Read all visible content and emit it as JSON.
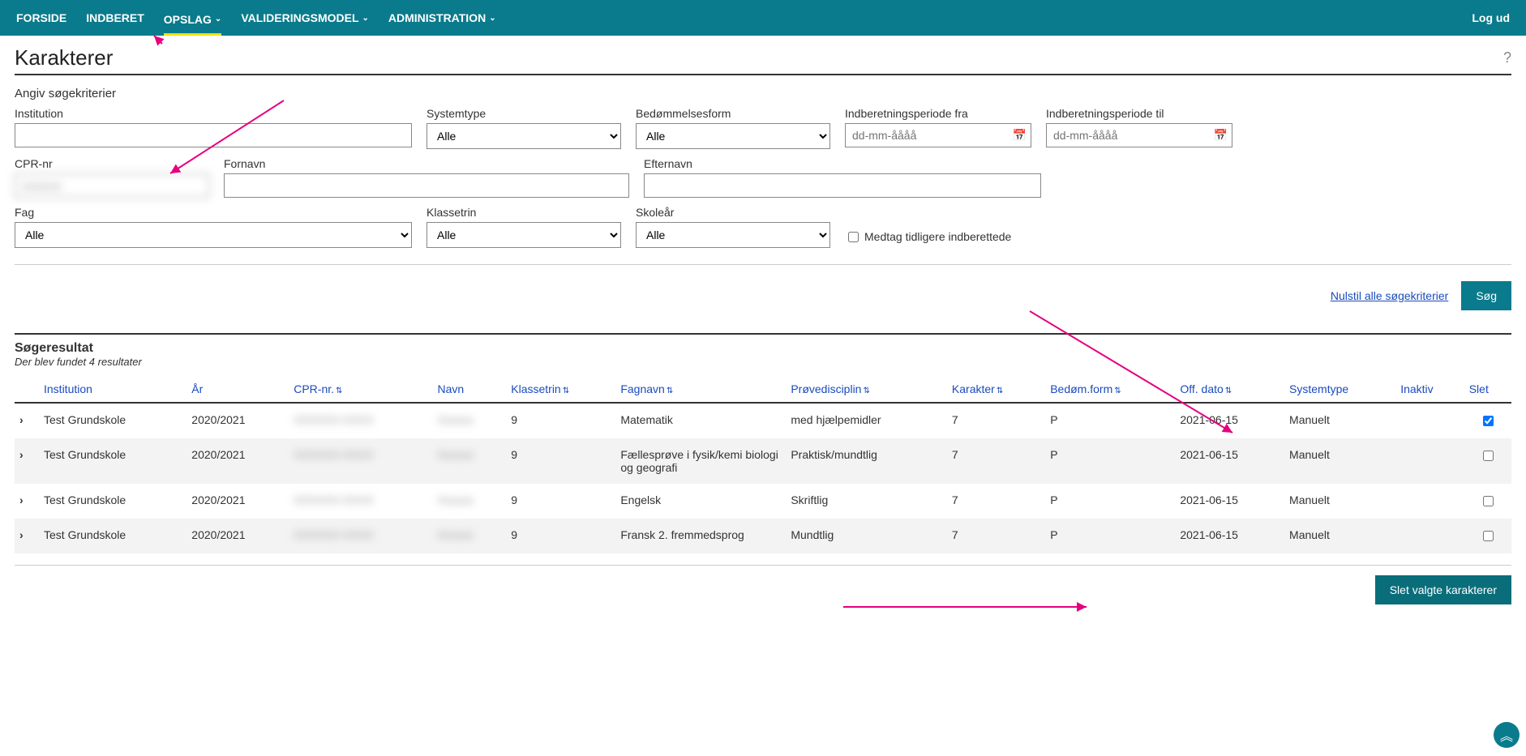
{
  "nav": {
    "items": [
      "FORSIDE",
      "INDBERET",
      "OPSLAG",
      "VALIDERINGSMODEL",
      "ADMINISTRATION"
    ],
    "logout": "Log ud"
  },
  "page": {
    "title": "Karakterer",
    "help_icon": "?",
    "section_label": "Angiv søgekriterier"
  },
  "form": {
    "institution_label": "Institution",
    "systemtype_label": "Systemtype",
    "systemtype_value": "Alle",
    "bedom_label": "Bedømmelsesform",
    "bedom_value": "Alle",
    "periode_fra_label": "Indberetningsperiode fra",
    "periode_fra_ph": "dd-mm-åååå",
    "periode_til_label": "Indberetningsperiode til",
    "periode_til_ph": "dd-mm-åååå",
    "cpr_label": "CPR-nr",
    "cpr_value": "",
    "fornavn_label": "Fornavn",
    "efternavn_label": "Efternavn",
    "fag_label": "Fag",
    "fag_value": "Alle",
    "klassetrin_label": "Klassetrin",
    "klassetrin_value": "Alle",
    "skoleaar_label": "Skoleår",
    "skoleaar_value": "Alle",
    "medtag_label": "Medtag tidligere indberettede",
    "reset_link": "Nulstil alle søgekriterier",
    "search_btn": "Søg"
  },
  "results": {
    "title": "Søgeresultat",
    "subtitle": "Der blev fundet 4 resultater",
    "headers": {
      "institution": "Institution",
      "aar": "År",
      "cpr": "CPR-nr.",
      "navn": "Navn",
      "klassetrin": "Klassetrin",
      "fagnavn": "Fagnavn",
      "provedisciplin": "Prøvedisciplin",
      "karakter": "Karakter",
      "bedomform": "Bedøm.form",
      "offdato": "Off. dato",
      "systemtype": "Systemtype",
      "inaktiv": "Inaktiv",
      "slet": "Slet"
    },
    "rows": [
      {
        "institution": "Test Grundskole",
        "aar": "2020/2021",
        "cpr": "XXXXXX-XXXX",
        "navn": "Xxxxxx",
        "klassetrin": "9",
        "fagnavn": "Matematik",
        "prove": "med hjælpemidler",
        "karakter": "7",
        "bedom": "P",
        "offdato": "2021-06-15",
        "systemtype": "Manuelt",
        "slet_checked": true
      },
      {
        "institution": "Test Grundskole",
        "aar": "2020/2021",
        "cpr": "XXXXXX-XXXX",
        "navn": "Xxxxxx",
        "klassetrin": "9",
        "fagnavn": "Fællesprøve i fysik/kemi biologi og geografi",
        "prove": "Praktisk/mundtlig",
        "karakter": "7",
        "bedom": "P",
        "offdato": "2021-06-15",
        "systemtype": "Manuelt",
        "slet_checked": false
      },
      {
        "institution": "Test Grundskole",
        "aar": "2020/2021",
        "cpr": "XXXXXX-XXXX",
        "navn": "Xxxxxx",
        "klassetrin": "9",
        "fagnavn": "Engelsk",
        "prove": "Skriftlig",
        "karakter": "7",
        "bedom": "P",
        "offdato": "2021-06-15",
        "systemtype": "Manuelt",
        "slet_checked": false
      },
      {
        "institution": "Test Grundskole",
        "aar": "2020/2021",
        "cpr": "XXXXXX-XXXX",
        "navn": "Xxxxxx",
        "klassetrin": "9",
        "fagnavn": "Fransk 2. fremmedsprog",
        "prove": "Mundtlig",
        "karakter": "7",
        "bedom": "P",
        "offdato": "2021-06-15",
        "systemtype": "Manuelt",
        "slet_checked": false
      }
    ],
    "delete_btn": "Slet valgte karakterer"
  }
}
